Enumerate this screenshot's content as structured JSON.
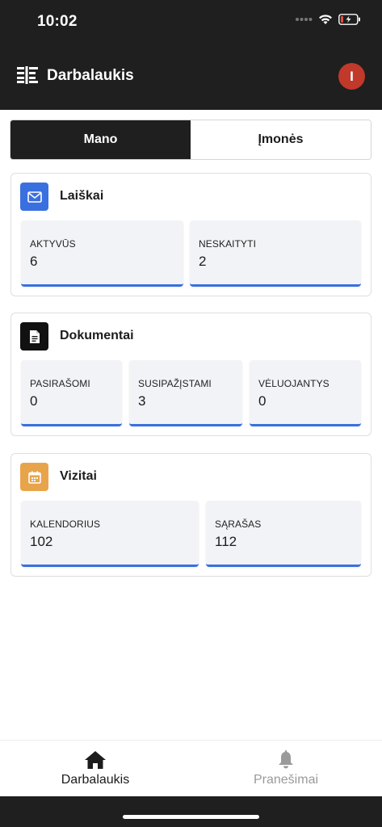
{
  "status_bar": {
    "time": "10:02"
  },
  "header": {
    "title": "Darbalaukis",
    "avatar_initial": "I",
    "avatar_color": "#c0392b"
  },
  "tabs": [
    {
      "label": "Mano",
      "active": true
    },
    {
      "label": "Įmonės",
      "active": false
    }
  ],
  "cards": {
    "laiskai": {
      "title": "Laiškai",
      "icon": "mail-icon",
      "icon_color": "#3a6fe0",
      "stats": [
        {
          "label": "AKTYVŪS",
          "value": "6"
        },
        {
          "label": "NESKAITYTI",
          "value": "2"
        }
      ]
    },
    "dokumentai": {
      "title": "Dokumentai",
      "icon": "document-icon",
      "icon_color": "#111111",
      "stats": [
        {
          "label": "PASIRAŠOMI",
          "value": "0"
        },
        {
          "label": "SUSIPAŽĮSTAMI",
          "value": "3"
        },
        {
          "label": "VĖLUOJANTYS",
          "value": "0"
        }
      ]
    },
    "vizitai": {
      "title": "Vizitai",
      "icon": "calendar-icon",
      "icon_color": "#e8a44a",
      "stats": [
        {
          "label": "KALENDORIUS",
          "value": "102"
        },
        {
          "label": "SĄRAŠAS",
          "value": "112"
        }
      ]
    }
  },
  "bottom_nav": [
    {
      "label": "Darbalaukis",
      "icon": "home-icon",
      "active": true
    },
    {
      "label": "Pranešimai",
      "icon": "bell-icon",
      "active": false
    }
  ],
  "colors": {
    "dark": "#1f1f1f",
    "accent": "#3a6fe0",
    "stat_bg": "#f1f3f6"
  }
}
